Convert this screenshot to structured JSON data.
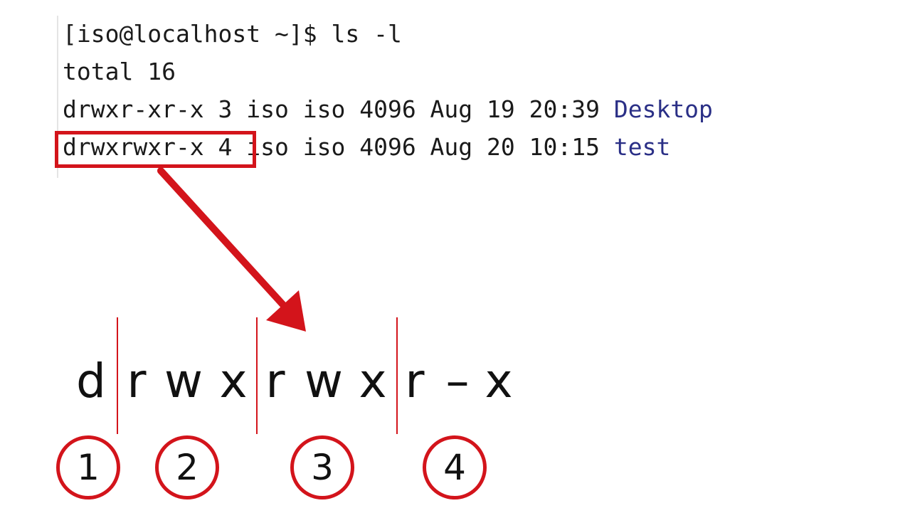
{
  "terminal": {
    "prompt_line": "[iso@localhost ~]$ ls -l",
    "total_line": "total 16",
    "rows": [
      {
        "prefix": "drwxr-xr-x 3 iso iso 4096 Aug 19 20:39 ",
        "name": "Desktop"
      },
      {
        "prefix": "drwxrwxr-x 4 iso iso 4096 Aug 20 10:15 ",
        "name": "test"
      }
    ]
  },
  "breakdown": {
    "chars": [
      "d",
      "r",
      "w",
      "x",
      "r",
      "w",
      "x",
      "r",
      "–",
      "x"
    ],
    "groups": [
      "1",
      "2",
      "3",
      "4"
    ]
  },
  "colors": {
    "accent_red": "#d3141b",
    "directory_name": "#2a2f86",
    "terminal_text": "#1a1a1a"
  }
}
